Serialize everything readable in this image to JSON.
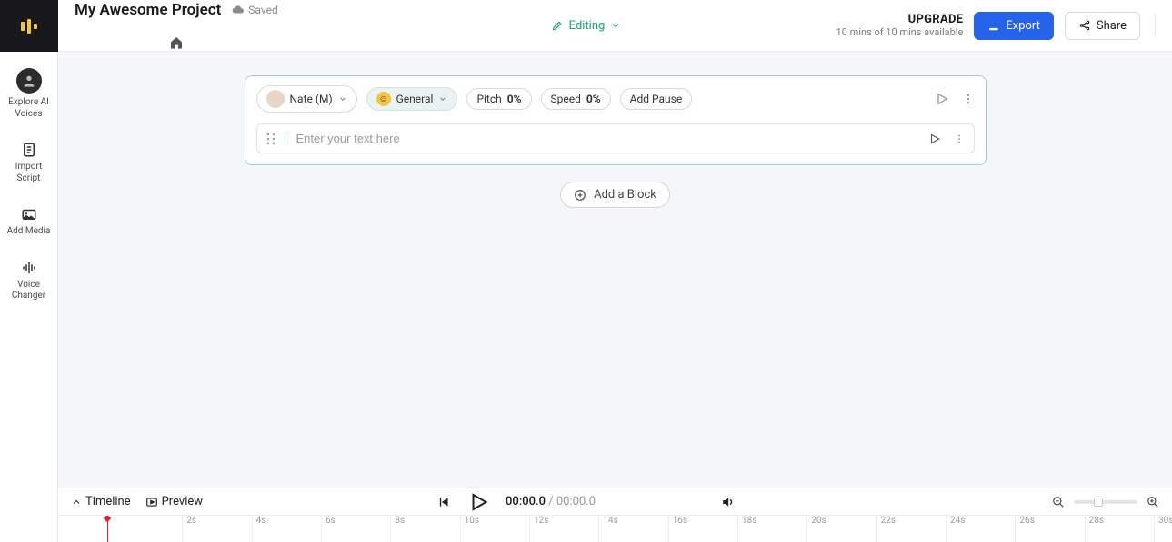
{
  "header": {
    "project_title": "My Awesome Project",
    "saved_label": "Saved",
    "mode_label": "Editing",
    "upgrade_title": "UPGRADE",
    "upgrade_sub": "10 mins of 10 mins available",
    "export_label": "Export",
    "share_label": "Share"
  },
  "sidebar": {
    "items": [
      {
        "label": "Explore AI\nVoices"
      },
      {
        "label": "Import\nScript"
      },
      {
        "label": "Add Media"
      },
      {
        "label": "Voice\nChanger"
      }
    ]
  },
  "block": {
    "voice_name": "Nate (M)",
    "emotion_label": "General",
    "pitch_label": "Pitch",
    "pitch_value": "0%",
    "speed_label": "Speed",
    "speed_value": "0%",
    "add_pause_label": "Add Pause",
    "text_placeholder": "Enter your text here",
    "add_block_label": "Add a Block"
  },
  "controls": {
    "timeline_label": "Timeline",
    "preview_label": "Preview",
    "time_current": "00:00.0",
    "time_sep": " / ",
    "time_total": "00:00.0"
  },
  "ruler": {
    "ticks": [
      "2s",
      "4s",
      "6s",
      "8s",
      "10s",
      "12s",
      "14s",
      "16s",
      "18s",
      "20s",
      "22s",
      "24s",
      "26s",
      "28s",
      "30s"
    ]
  }
}
